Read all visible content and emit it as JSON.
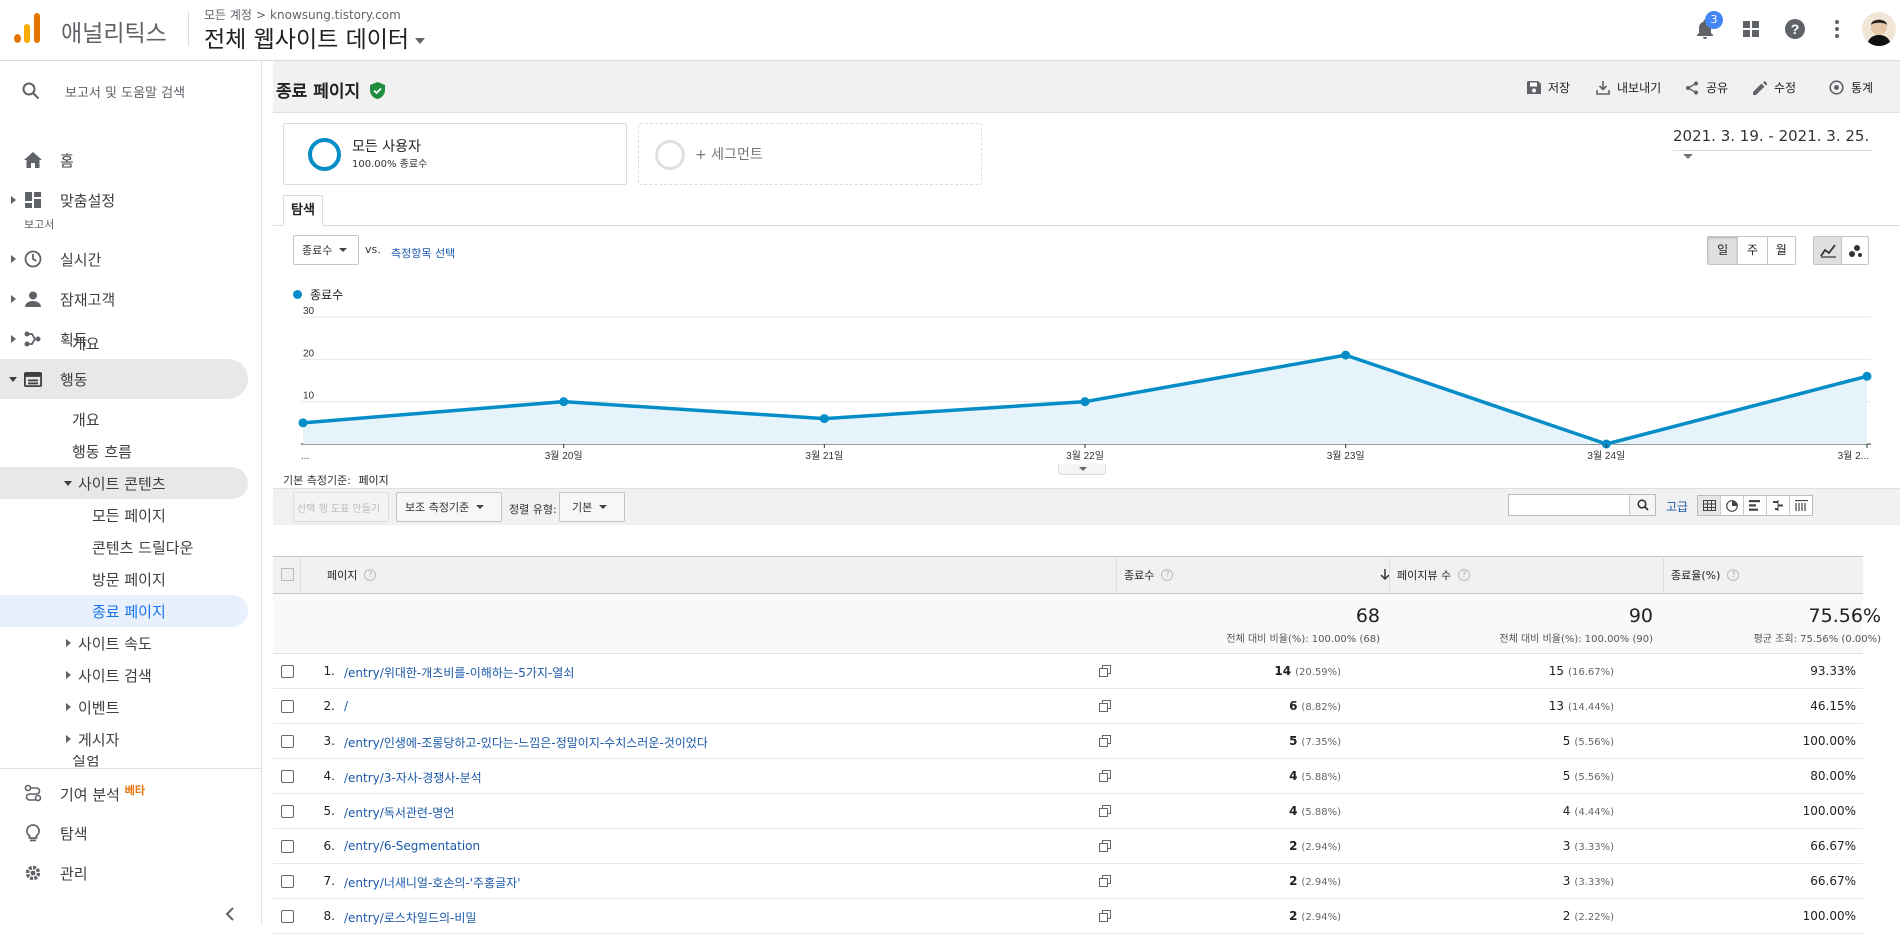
{
  "app": {
    "brand": "애널리틱스"
  },
  "header": {
    "breadcrumb_account": "모든 계정",
    "breadcrumb_site": "knowsung.tistory.com",
    "property": "전체 웹사이트 데이터",
    "notification_count": "3"
  },
  "sidebar": {
    "search_placeholder": "보고서 및 도움말 검색",
    "home": "홈",
    "customization": "맞춤설정",
    "reports_header": "보고서",
    "realtime": "실시간",
    "audience": "잠재고객",
    "acquisition": "획득",
    "behavior": "행동",
    "behavior_sub": {
      "overview": "개요",
      "behavior_flow": "행동 흐름",
      "site_content": "사이트 콘텐츠",
      "all_pages": "모든 페이지",
      "content_drilldown": "콘텐츠 드릴다운",
      "landing_pages": "방문 페이지",
      "exit_pages": "종료 페이지",
      "site_speed": "사이트 속도",
      "site_search": "사이트 검색",
      "events": "이벤트",
      "publisher": "게시자",
      "experiments": "실험"
    },
    "attribution": "기여 분석",
    "attribution_badge": "베타",
    "discover": "탐색",
    "admin": "관리"
  },
  "toolbar": {
    "title": "종료 페이지",
    "save": "저장",
    "export": "내보내기",
    "share": "공유",
    "edit": "수정",
    "insights": "통계"
  },
  "segments": {
    "all_users": "모든 사용자",
    "all_users_sub": "100.00% 종료수",
    "add_segment": "+ 세그먼트"
  },
  "date_range": "2021. 3. 19. - 2021. 3. 25.",
  "tabs": {
    "explorer": "탐색"
  },
  "chart_controls": {
    "metric": "종료수",
    "vs": "vs.",
    "select_metric": "측정항목 선택",
    "day": "일",
    "week": "주",
    "month": "월"
  },
  "chart_data": {
    "type": "area",
    "legend": "종료수",
    "x_labels": [
      "...",
      "3월 20일",
      "3월 21일",
      "3월 22일",
      "3월 23일",
      "3월 24일",
      "3월 2..."
    ],
    "x": [
      "3월 19일",
      "3월 20일",
      "3월 21일",
      "3월 22일",
      "3월 23일",
      "3월 24일",
      "3월 25일"
    ],
    "values": [
      5,
      10,
      6,
      10,
      21,
      0,
      16
    ],
    "yticks": [
      "10",
      "20",
      "30"
    ],
    "ylim": [
      0,
      30
    ],
    "color": "#058dc7",
    "fill": "#e6f3fa"
  },
  "table_controls": {
    "primary_dimension_label": "기본 측정기준:",
    "primary_dimension": "페이지",
    "plot_rows": "선택 행 도표 만들기",
    "secondary_dimension": "보조 측정기준",
    "sort_type_label": "정렬 유형:",
    "sort_type": "기본",
    "advanced": "고급"
  },
  "table": {
    "headers": [
      "페이지",
      "종료수",
      "페이지뷰 수",
      "종료율(%)"
    ],
    "totals": {
      "exits": "68",
      "exits_sub": "전체 대비 비율(%): 100.00% (68)",
      "pageviews": "90",
      "pageviews_sub": "전체 대비 비율(%): 100.00% (90)",
      "exit_rate": "75.56%",
      "exit_rate_sub": "평균 조회: 75.56% (0.00%)"
    },
    "rows": [
      {
        "n": "1.",
        "page": "/entry/위대한-개츠비를-이해하는-5가지-열쇠",
        "exits": "14",
        "exits_pct": "(20.59%)",
        "pv": "15",
        "pv_pct": "(16.67%)",
        "rate": "93.33%"
      },
      {
        "n": "2.",
        "page": "/",
        "exits": "6",
        "exits_pct": "(8.82%)",
        "pv": "13",
        "pv_pct": "(14.44%)",
        "rate": "46.15%"
      },
      {
        "n": "3.",
        "page": "/entry/인생에-조롱당하고-있다는-느낌은-정말이지-수치스러운-것이었다",
        "exits": "5",
        "exits_pct": "(7.35%)",
        "pv": "5",
        "pv_pct": "(5.56%)",
        "rate": "100.00%"
      },
      {
        "n": "4.",
        "page": "/entry/3-자사-경쟁사-분석",
        "exits": "4",
        "exits_pct": "(5.88%)",
        "pv": "5",
        "pv_pct": "(5.56%)",
        "rate": "80.00%"
      },
      {
        "n": "5.",
        "page": "/entry/독서관련-명언",
        "exits": "4",
        "exits_pct": "(5.88%)",
        "pv": "4",
        "pv_pct": "(4.44%)",
        "rate": "100.00%"
      },
      {
        "n": "6.",
        "page": "/entry/6-Segmentation",
        "exits": "2",
        "exits_pct": "(2.94%)",
        "pv": "3",
        "pv_pct": "(3.33%)",
        "rate": "66.67%"
      },
      {
        "n": "7.",
        "page": "/entry/너새니얼-호손의-'주홍글자'",
        "exits": "2",
        "exits_pct": "(2.94%)",
        "pv": "3",
        "pv_pct": "(3.33%)",
        "rate": "66.67%"
      },
      {
        "n": "8.",
        "page": "/entry/로스차일드의-비밀",
        "exits": "2",
        "exits_pct": "(2.94%)",
        "pv": "2",
        "pv_pct": "(2.22%)",
        "rate": "100.00%"
      }
    ]
  },
  "colors": {
    "accent_blue": "#1a73e8",
    "link_blue": "#1a58a8",
    "series_blue": "#058dc7",
    "logo_orange": "#f9ab00",
    "logo_dark_orange": "#e37400",
    "verified_green": "#1e8e3e",
    "badge_orange": "#e8710a"
  }
}
